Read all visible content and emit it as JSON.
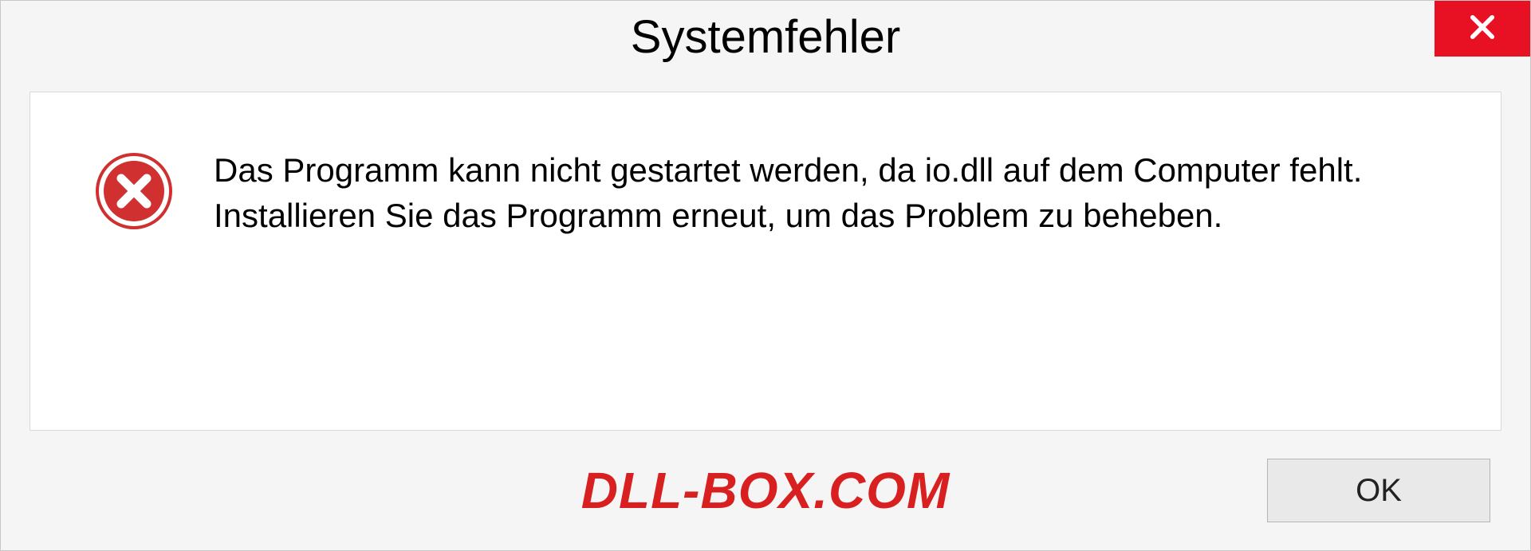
{
  "dialog": {
    "title": "Systemfehler",
    "message": "Das Programm kann nicht gestartet werden, da io.dll auf dem Computer fehlt. Installieren Sie das Programm erneut, um das Problem zu beheben.",
    "ok_label": "OK"
  },
  "watermark": "DLL-BOX.COM",
  "colors": {
    "close_bg": "#e81123",
    "watermark": "#d82020"
  }
}
